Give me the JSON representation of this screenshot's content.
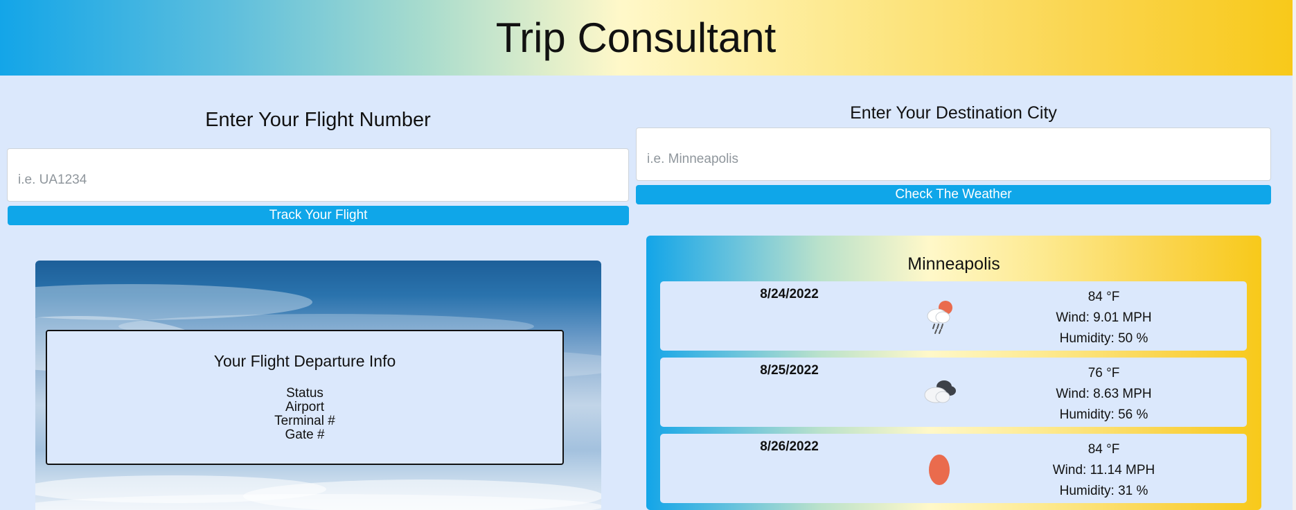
{
  "header": {
    "title": "Trip Consultant"
  },
  "flight_search": {
    "title": "Enter Your Flight Number",
    "placeholder": "i.e. UA1234",
    "value": "",
    "button_label": "Track Your Flight"
  },
  "weather_search": {
    "title": "Enter Your Destination City",
    "placeholder": "i.e. Minneapolis",
    "value": "",
    "button_label": "Check The Weather"
  },
  "flight_info": {
    "title": "Your Flight Departure Info",
    "fields": [
      "Status",
      "Airport",
      "Terminal #",
      "Gate #"
    ]
  },
  "weather": {
    "city": "Minneapolis",
    "days": [
      {
        "date": "8/24/2022",
        "icon": "rain-cloud-sun-icon",
        "temp": "84 °F",
        "wind": "Wind: 9.01 MPH",
        "humidity": "Humidity: 50 %"
      },
      {
        "date": "8/25/2022",
        "icon": "dark-clouds-icon",
        "temp": "76 °F",
        "wind": "Wind: 8.63 MPH",
        "humidity": "Humidity: 56 %"
      },
      {
        "date": "8/26/2022",
        "icon": "sun-icon",
        "temp": "84 °F",
        "wind": "Wind: 11.14 MPH",
        "humidity": "Humidity: 31 %"
      }
    ]
  },
  "colors": {
    "accent": "#0fa6e9",
    "page_background": "#dbe8fc",
    "gradient_blue": "#13a5e8",
    "gradient_yellow": "#f8c91a",
    "sun_orange": "#ea6b4d"
  }
}
